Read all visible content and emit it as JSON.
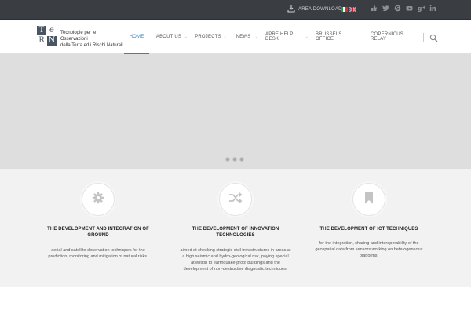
{
  "topbar": {
    "download_label": "AREA DOWNLOAD",
    "download_icon": "download-icon",
    "languages": [
      "it",
      "en"
    ],
    "socials": [
      "thumbs-up-icon",
      "twitter-icon",
      "skype-icon",
      "youtube-icon",
      "google-plus-icon",
      "linkedin-icon"
    ],
    "background_color": "#3a3e42"
  },
  "header": {
    "logo_letters": [
      "T",
      "e",
      "R",
      "N"
    ],
    "tagline_line1": "Tecnologie per le Osservazioni",
    "tagline_line2": "della Terra ed i Rischi Naturali",
    "nav": [
      {
        "label": "HOME",
        "active": true
      },
      {
        "label": "ABOUT US",
        "active": false
      },
      {
        "label": "PROJECTS",
        "active": false
      },
      {
        "label": "NEWS",
        "active": false
      },
      {
        "label": "APRE HELP DESK",
        "active": false
      },
      {
        "label": "BRUSSELS OFFICE",
        "active": false
      },
      {
        "label": "COPERNICUS RELAY",
        "active": false
      }
    ],
    "accent_color": "#2a86c8",
    "search_icon": "search-icon"
  },
  "slider": {
    "background_color": "#dedede",
    "dot_count": 3
  },
  "features": [
    {
      "icon": "gear-icon",
      "title_line1": "THE DEVELOPMENT AND INTEGRATION OF",
      "title_line2": "GROUND",
      "desc_lines": [
        "aerial and satellite observation techniques for the",
        "prediction, monitoring and mitigation of natural risks."
      ]
    },
    {
      "icon": "shuffle-icon",
      "title_line1": "THE DEVELOPMENT OF INNOVATION",
      "title_line2": "TECHNOLOGIES",
      "desc_lines": [
        "aimed at checking strategic civil infrastructures in areas at",
        "a high seismic and hydro-geological risk, paying special",
        "attention to earthquake-proof buildings and the",
        "development of non-destructive diagnostic techniques."
      ]
    },
    {
      "icon": "bookmark-icon",
      "title_line1": "THE DEVELOPMENT OF ICT TECHNIQUES",
      "title_line2": "",
      "desc_lines": [
        "for the integration, sharing and interoperability of the",
        "geospatial data from sensors working on heterogeneous",
        "platforms."
      ]
    }
  ]
}
